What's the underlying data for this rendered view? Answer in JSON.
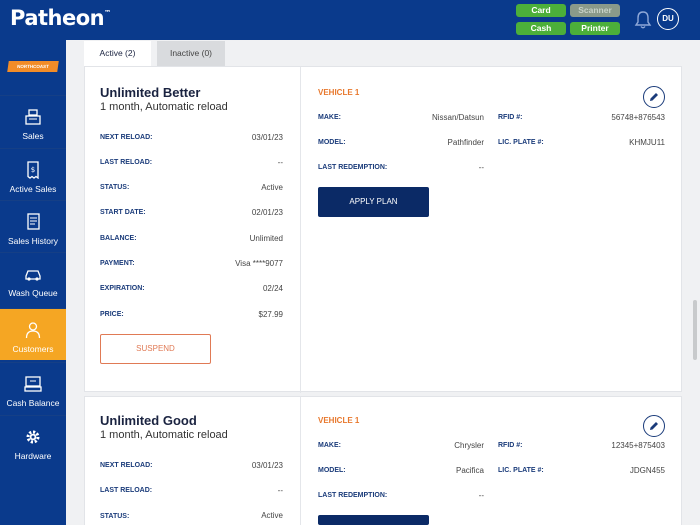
{
  "app": {
    "logo": "Patheon",
    "tm": "™"
  },
  "header": {
    "pills": [
      "Card",
      "Scanner",
      "Cash",
      "Printer"
    ],
    "avatar_initials": "DU"
  },
  "sidebar": {
    "brand_badge": "NORTHCOAST",
    "items": [
      {
        "label": "Sales",
        "icon": "register-icon"
      },
      {
        "label": "Active Sales",
        "icon": "receipt-icon"
      },
      {
        "label": "Sales History",
        "icon": "history-icon"
      },
      {
        "label": "Wash Queue",
        "icon": "car-icon"
      },
      {
        "label": "Customers",
        "icon": "person-icon"
      },
      {
        "label": "Cash Balance",
        "icon": "cash-register-icon"
      },
      {
        "label": "Hardware",
        "icon": "gear-icon"
      }
    ]
  },
  "tabs": {
    "active": "Active (2)",
    "inactive": "Inactive (0)"
  },
  "labels": {
    "next_reload": "NEXT RELOAD:",
    "last_reload": "LAST RELOAD:",
    "status": "STATUS:",
    "start_date": "START DATE:",
    "balance": "BALANCE:",
    "payment": "PAYMENT:",
    "expiration": "EXPIRATION:",
    "price": "PRICE:",
    "make": "MAKE:",
    "model": "MODEL:",
    "last_redemption": "LAST REDEMPTION:",
    "rfid": "RFID #:",
    "plate": "LIC. PLATE #:",
    "suspend": "SUSPEND",
    "apply_plan": "APPLY PLAN"
  },
  "plans": [
    {
      "title": "Unlimited Better",
      "subtitle": "1 month, Automatic reload",
      "next_reload": "03/01/23",
      "last_reload": "--",
      "status": "Active",
      "start_date": "02/01/23",
      "balance": "Unlimited",
      "payment": "Visa ****9077",
      "expiration": "02/24",
      "price": "$27.99",
      "vehicle": {
        "title": "VEHICLE 1",
        "make": "Nissan/Datsun",
        "model": "Pathfinder",
        "last_redemption": "--",
        "rfid": "56748+876543",
        "plate": "KHMJU11"
      }
    },
    {
      "title": "Unlimited Good",
      "subtitle": "1 month, Automatic reload",
      "next_reload": "03/01/23",
      "last_reload": "--",
      "status": "Active",
      "vehicle": {
        "title": "VEHICLE 1",
        "make": "Chrysler",
        "model": "Pacifica",
        "last_redemption": "--",
        "rfid": "12345+875403",
        "plate": "JDGN455"
      }
    }
  ],
  "colors": {
    "primary": "#0a3a8c",
    "accent": "#f5a623",
    "vehicle_title": "#e8782d",
    "pill_green": "#4caf3a"
  }
}
